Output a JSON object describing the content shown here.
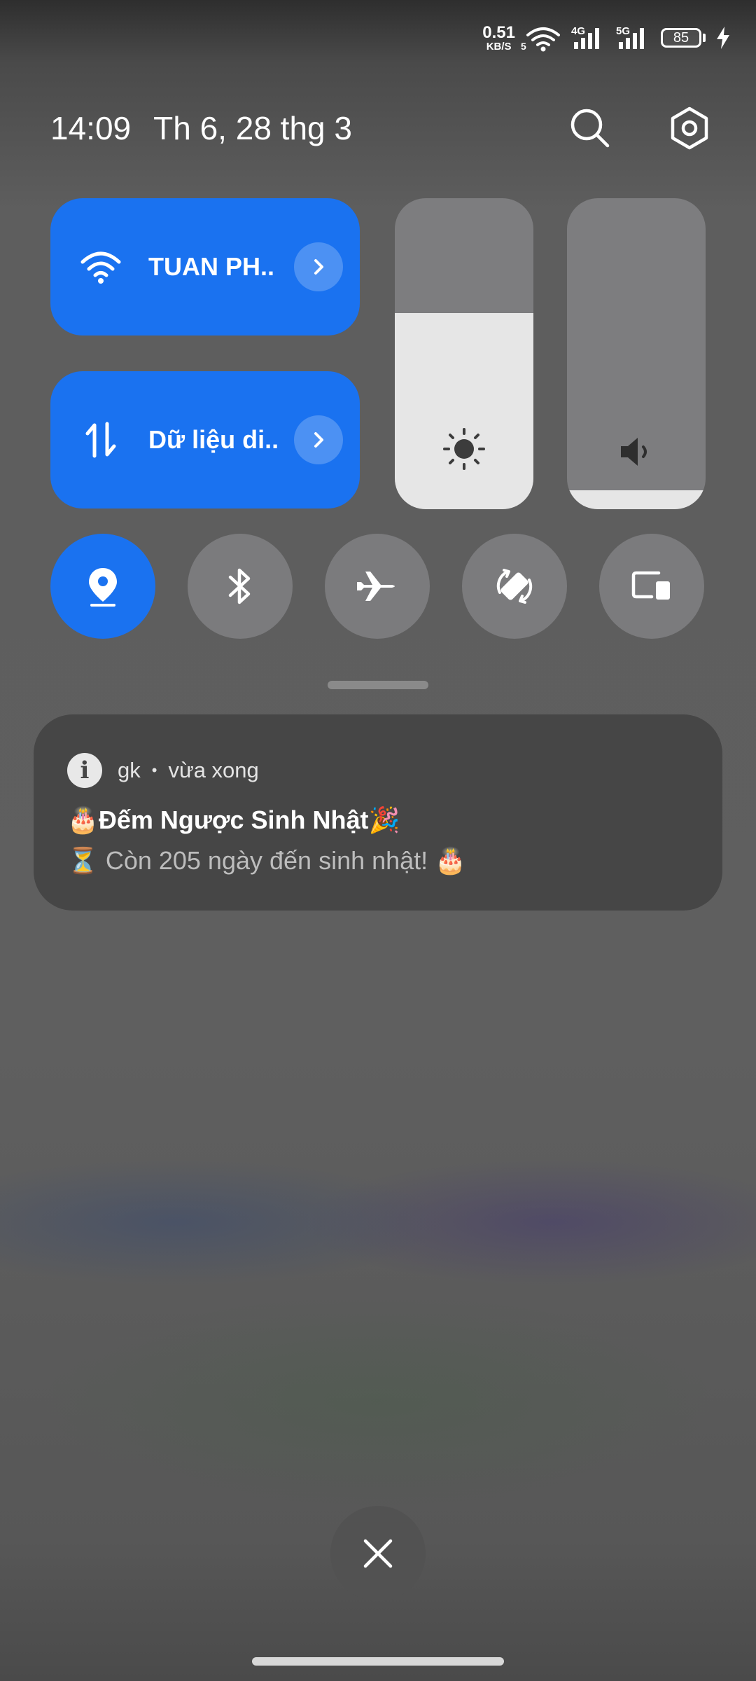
{
  "status_bar": {
    "net_speed_value": "0.51",
    "net_speed_unit": "KB/S",
    "wifi_sub": "5",
    "sim1_label": "4G",
    "sim2_label": "5G",
    "battery_level": "85",
    "charging": true
  },
  "header": {
    "time": "14:09",
    "date": "Th 6, 28 thg 3",
    "search_icon": "search-icon",
    "settings_icon": "settings-icon"
  },
  "tiles": {
    "wifi": {
      "label": "TUAN PH..",
      "icon": "wifi-icon",
      "active": true
    },
    "mobile_data": {
      "label": "Dữ liệu di..",
      "icon": "data-transfer-icon",
      "active": true
    }
  },
  "sliders": {
    "brightness": {
      "level": 0.63,
      "icon": "brightness-icon"
    },
    "volume": {
      "level": 0.06,
      "icon": "volume-icon"
    }
  },
  "toggles": [
    {
      "name": "location",
      "icon": "location-icon",
      "active": true
    },
    {
      "name": "bluetooth",
      "icon": "bluetooth-icon",
      "active": false
    },
    {
      "name": "airplane",
      "icon": "airplane-icon",
      "active": false
    },
    {
      "name": "auto-rotate",
      "icon": "rotate-icon",
      "active": false
    },
    {
      "name": "screen-cast",
      "icon": "screen-cast-icon",
      "active": false
    }
  ],
  "notification": {
    "app_name": "gk",
    "separator": "•",
    "time": "vừa xong",
    "title": "🎂Đếm Ngược Sinh Nhật🎉",
    "body": "⏳ Còn 205 ngày đến sinh nhật! 🎂"
  },
  "colors": {
    "accent": "#1a72f0",
    "tile_off": "#7b7b7d",
    "notification_bg": "#464646"
  }
}
